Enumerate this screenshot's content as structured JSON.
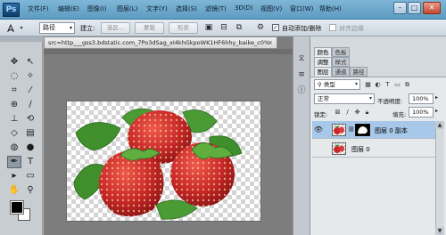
{
  "app": {
    "logo_text": "Ps",
    "menu": [
      "文件(F)",
      "编辑(E)",
      "图像(I)",
      "图层(L)",
      "文字(Y)",
      "选择(S)",
      "滤镜(T)",
      "3D(D)",
      "视图(V)",
      "窗口(W)",
      "帮助(H)"
    ],
    "window_controls": {
      "minimize": "–",
      "restore": "□",
      "close": "✕"
    }
  },
  "options_bar": {
    "tool_icon": "pen-tool-icon",
    "mode_value": "路径",
    "build_label": "建立:",
    "buttons": [
      "选区...",
      "蒙版",
      "形状"
    ],
    "auto_add_delete_label": "自动添加/删除",
    "auto_add_delete_checked": true,
    "align_edges_label": "对齐边缘",
    "align_edges_checked": false
  },
  "document": {
    "tab_title": "src=http___gss3.bdstatic.com_7Po3dSag_xI4khGkpoWK1HF6hhy_baike_c0%",
    "close_glyph": "×"
  },
  "color_panel": {
    "tabs": [
      "颜色",
      "色板"
    ]
  },
  "adjust_panel": {
    "tabs": [
      "调整",
      "样式"
    ]
  },
  "layers_panel": {
    "tabs": [
      "图层",
      "通道",
      "路径"
    ],
    "filter_kind": "类型",
    "blend_mode": "正常",
    "opacity_label": "不透明度:",
    "opacity_value": "100%",
    "lock_label": "锁定:",
    "fill_label": "填充:",
    "fill_value": "100%",
    "layers": [
      {
        "name": "图层 0 副本",
        "selected": true,
        "visible": true,
        "has_mask": true
      },
      {
        "name": "图层 0",
        "selected": false,
        "visible": false,
        "has_mask": false
      }
    ]
  },
  "colors": {
    "menubar": "#6aa6cb",
    "selected_layer": "#a7c8e8",
    "strawberry": "#c8282a",
    "leaf": "#3f8f2c"
  }
}
